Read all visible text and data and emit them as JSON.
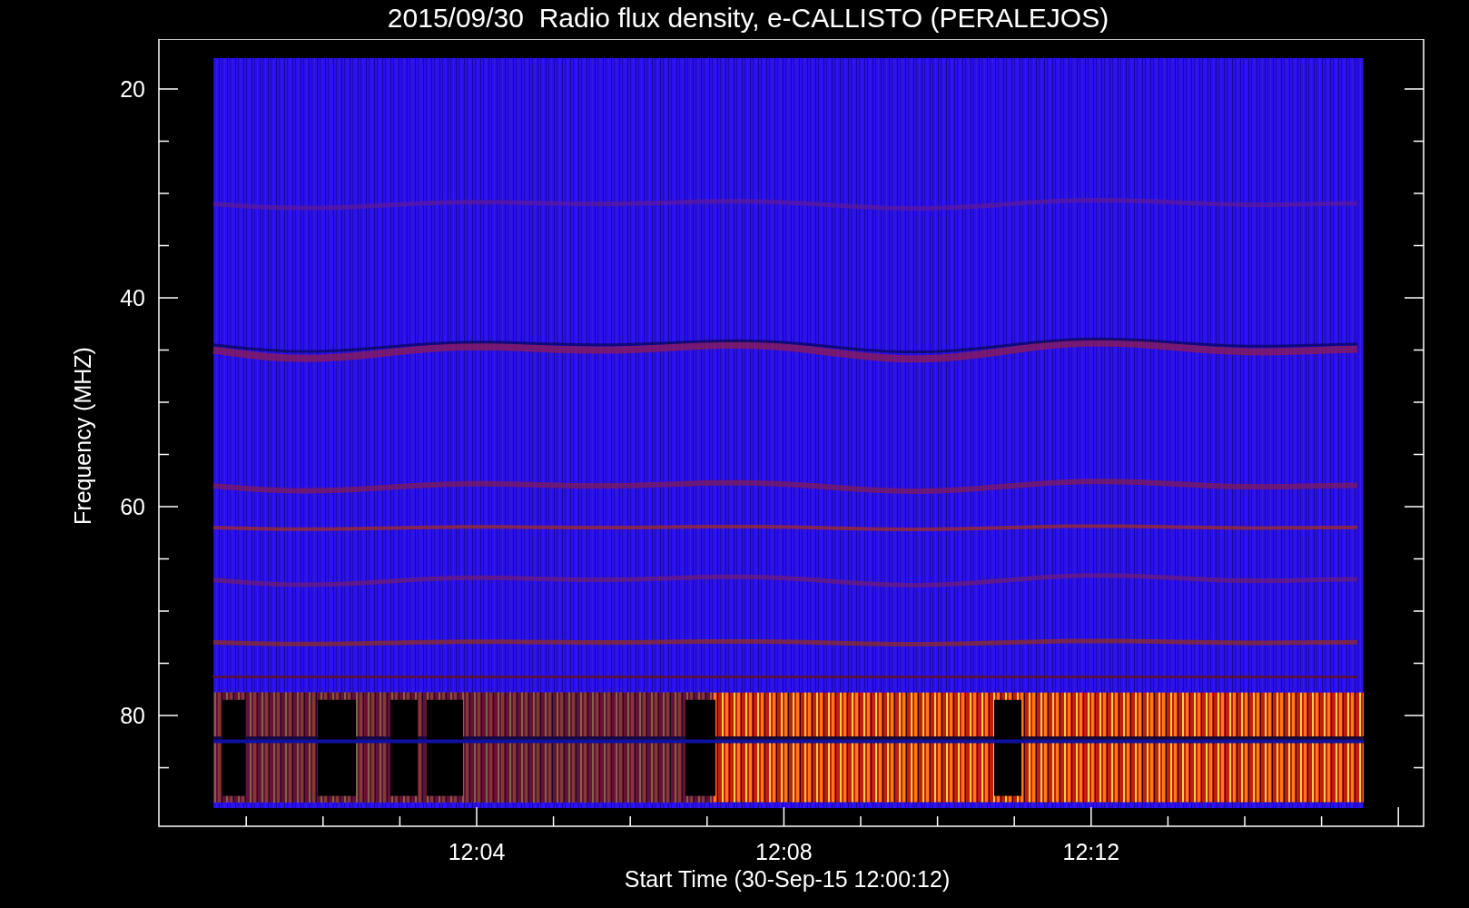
{
  "title": "2015/09/30  Radio flux density, e-CALLISTO (PERALEJOS)",
  "plot": {
    "ylabel": "Frequency (MHZ)",
    "xlabel": "Start Time (30-Sep-15 12:00:12)",
    "y_tick_labels": [
      "20",
      "40",
      "60",
      "80"
    ],
    "x_tick_labels": [
      "12:04",
      "12:08",
      "12:12"
    ]
  }
}
